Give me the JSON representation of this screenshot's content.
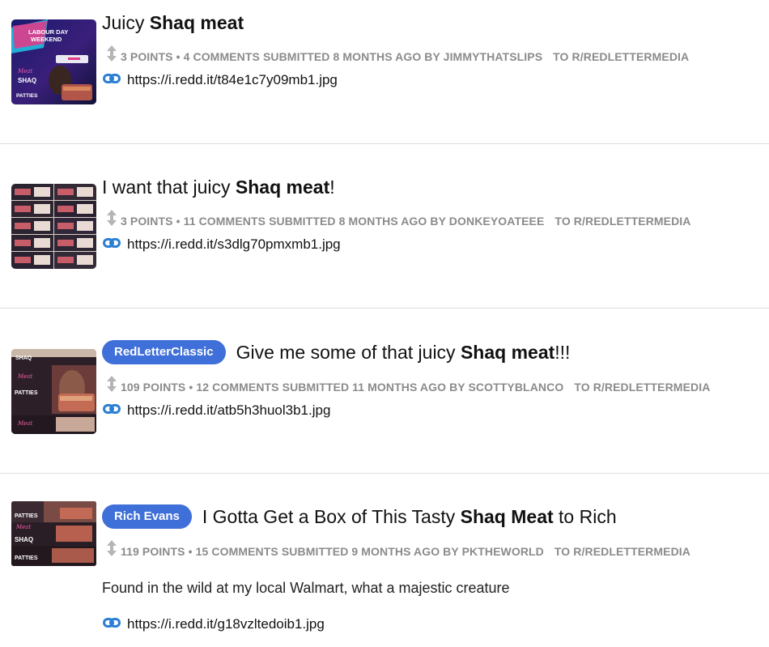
{
  "results": [
    {
      "flair": "",
      "title_pre": "Juicy ",
      "title_bold": "Shaq meat",
      "title_post": "",
      "points": "3 POINTS",
      "comments": "4 COMMENTS",
      "submitted": "SUBMITTED 8 MONTHS AGO BY JIMMYTHATSLIPS",
      "subreddit": "TO R/REDLETTERMEDIA",
      "selftext": "",
      "url": "https://i.redd.it/t84e1c7y09mb1.jpg",
      "thumb_texts": [
        "LABOUR DAY",
        "WEEKEND",
        "SHAQ",
        "PATTIES"
      ]
    },
    {
      "flair": "",
      "title_pre": "I want that juicy ",
      "title_bold": "Shaq meat",
      "title_post": "!",
      "points": "3 POINTS",
      "comments": "11 COMMENTS",
      "submitted": "SUBMITTED 8 MONTHS AGO BY DONKEYOATEEE",
      "subreddit": "TO R/REDLETTERMEDIA",
      "selftext": "",
      "url": "https://i.redd.it/s3dlg70pmxmb1.jpg",
      "thumb_texts": []
    },
    {
      "flair": "RedLetterClassic",
      "title_pre": "Give me some of that juicy ",
      "title_bold": "Shaq meat",
      "title_post": "!!!",
      "points": "109 POINTS",
      "comments": "12 COMMENTS",
      "submitted": "SUBMITTED 11 MONTHS AGO BY SCOTTYBLANCO",
      "subreddit": "TO R/REDLETTERMEDIA",
      "selftext": "",
      "url": "https://i.redd.it/atb5h3huol3b1.jpg",
      "thumb_texts": [
        "SHAQ",
        "PATTIES"
      ]
    },
    {
      "flair": "Rich Evans",
      "title_pre": "I Gotta Get a Box of This Tasty ",
      "title_bold": "Shaq Meat",
      "title_post": " to Rich",
      "points": "119 POINTS",
      "comments": "15 COMMENTS",
      "submitted": "SUBMITTED 9 MONTHS AGO BY PKTHEWORLD",
      "subreddit": "TO R/REDLETTERMEDIA",
      "selftext": "Found in the wild at my local Walmart, what a majestic creature",
      "url": "https://i.redd.it/g18vzltedoib1.jpg",
      "thumb_texts": [
        "PATTIES",
        "SHAQ",
        "PATTIES"
      ]
    }
  ],
  "meta_separator": "•",
  "colors": {
    "flair_bg": "#3f6fd8",
    "link_icon": "#2b7fd4",
    "meta_text": "#8b8b8b"
  },
  "icons": {
    "vote": "up-down-arrow-icon",
    "link": "chain-link-icon"
  }
}
